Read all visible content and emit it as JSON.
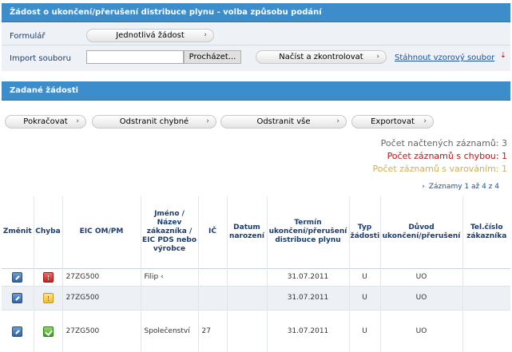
{
  "header": {
    "title": "Žádost o ukončení/přerušení distribuce plynu - volba způsobu podání"
  },
  "form": {
    "formular_label": "Formulář",
    "single_request_button": "Jednotlivá žádost",
    "import_label": "Import souboru",
    "file_value": "",
    "browse_button": "Procházet...",
    "load_check_button": "Načíst a zkontrolovat",
    "download_link": "Stáhnout vzorový soubor"
  },
  "section": {
    "title": "Zadané žádosti"
  },
  "actions": {
    "continue": "Pokračovat",
    "remove_faulty": "Odstranit chybné",
    "remove_all": "Odstranit vše",
    "export": "Exportovat"
  },
  "counts": {
    "loaded": "Počet načtených záznamů: 3",
    "errors": "Počet záznamů s chybou: 1",
    "warnings": "Počet záznamů s varováním: 1",
    "error_color": "#cc1111",
    "warning_color": "#d4b04a"
  },
  "pager": {
    "text": "Záznamy 1 až 4 z 4"
  },
  "table": {
    "columns": [
      "Změnit",
      "Chyba",
      "EIC OM/PM",
      "Jméno / Název zákazníka / EIC PDS nebo výrobce",
      "IČ",
      "Datum narození",
      "Termín ukončení/přerušení distribuce plynu",
      "Typ žádosti",
      "Důvod ukončení/přerušení",
      "Tel.číslo zákazníka"
    ],
    "rows": [
      {
        "status": "error",
        "eic": "27ZG500",
        "name": "Filip ‹",
        "ic": "",
        "birth": "",
        "term": "31.07.2011",
        "type": "U",
        "reason": "UO",
        "phone": ""
      },
      {
        "status": "warning",
        "eic": "27ZG500",
        "name": "",
        "ic": "",
        "birth": "",
        "term": "31.07.2011",
        "type": "U",
        "reason": "UO",
        "phone": ""
      },
      {
        "status": "ok",
        "eic": "27ZG500",
        "name": "Společenství",
        "ic": "27",
        "birth": "",
        "term": "31.07.2011",
        "type": "U",
        "reason": "UO",
        "phone": ""
      }
    ]
  }
}
